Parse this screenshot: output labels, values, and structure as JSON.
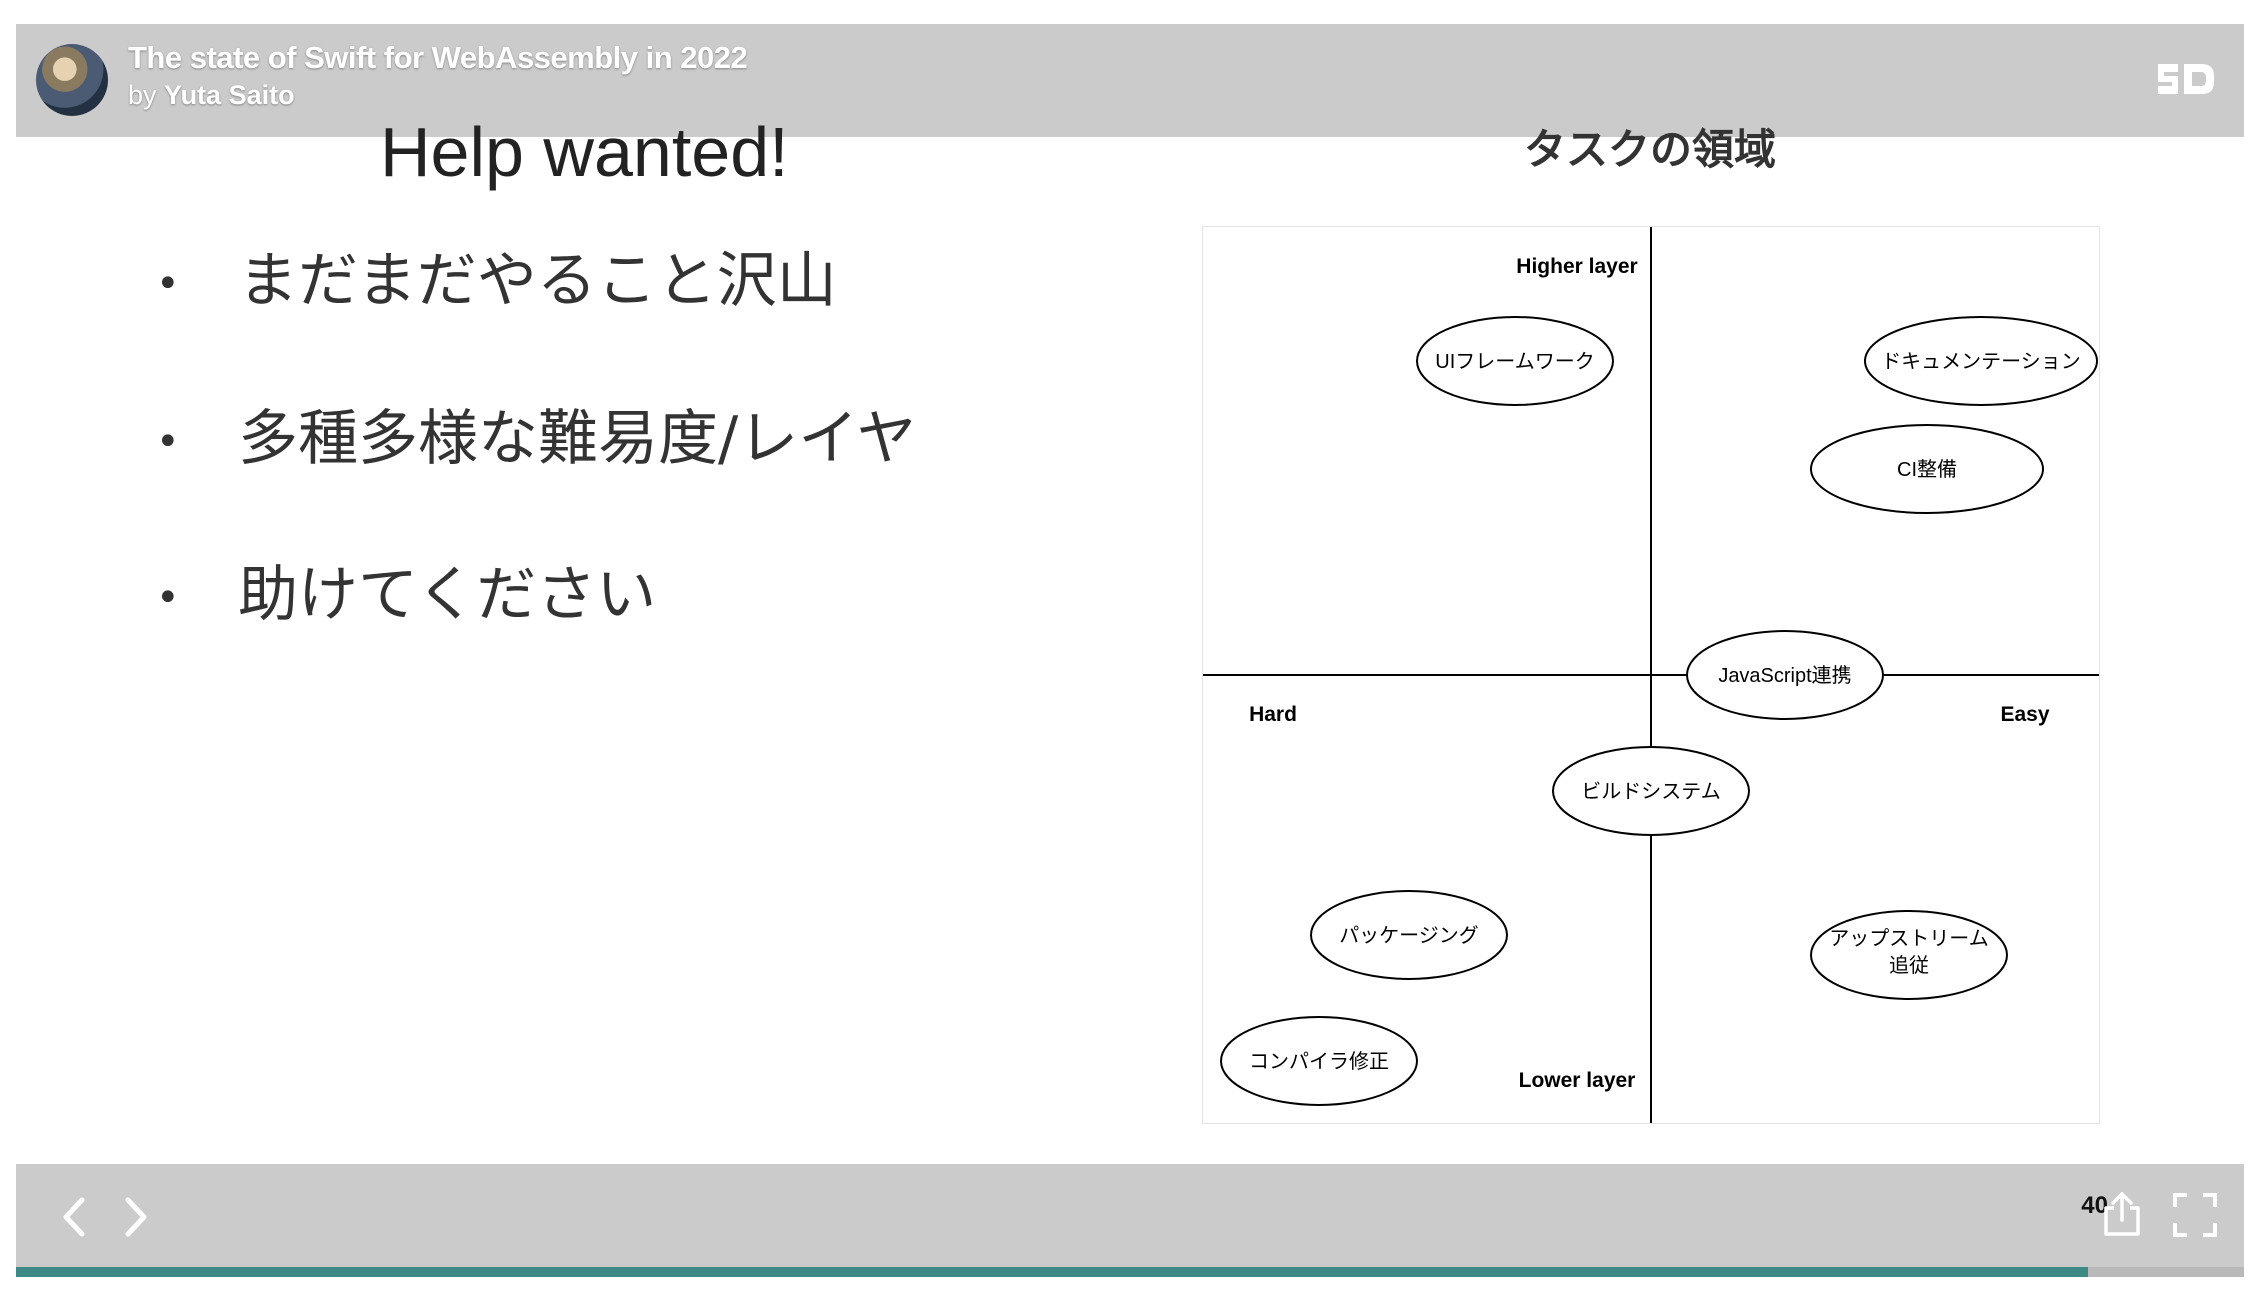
{
  "header": {
    "title": "The state of Swift for WebAssembly in 2022",
    "by_prefix": "by",
    "author": "Yuta Saito",
    "logo_icon": "speakerdeck-logo-icon"
  },
  "slide": {
    "heading": "Help wanted!",
    "bullets": [
      "まだまだやること沢山",
      "多種多様な難易度/レイヤ",
      "助けてください"
    ],
    "bullet_symbol": "•",
    "diagram": {
      "title": "タスクの領域",
      "axis_labels": {
        "top": "Higher layer",
        "bottom": "Lower layer",
        "left": "Hard",
        "right": "Easy"
      },
      "nodes": [
        "UIフレームワーク",
        "ドキュメンテーション",
        "CI整備",
        "JavaScript連携",
        "ビルドシステム",
        "パッケージング",
        "アップストリーム",
        "追従",
        "コンパイラ修正"
      ]
    }
  },
  "footer": {
    "page_number": "40",
    "progress_fraction": 0.93,
    "progress_color": "#3d8a85",
    "prev_icon": "chevron-left-icon",
    "next_icon": "chevron-right-icon",
    "share_icon": "share-icon",
    "fullscreen_icon": "fullscreen-icon"
  }
}
